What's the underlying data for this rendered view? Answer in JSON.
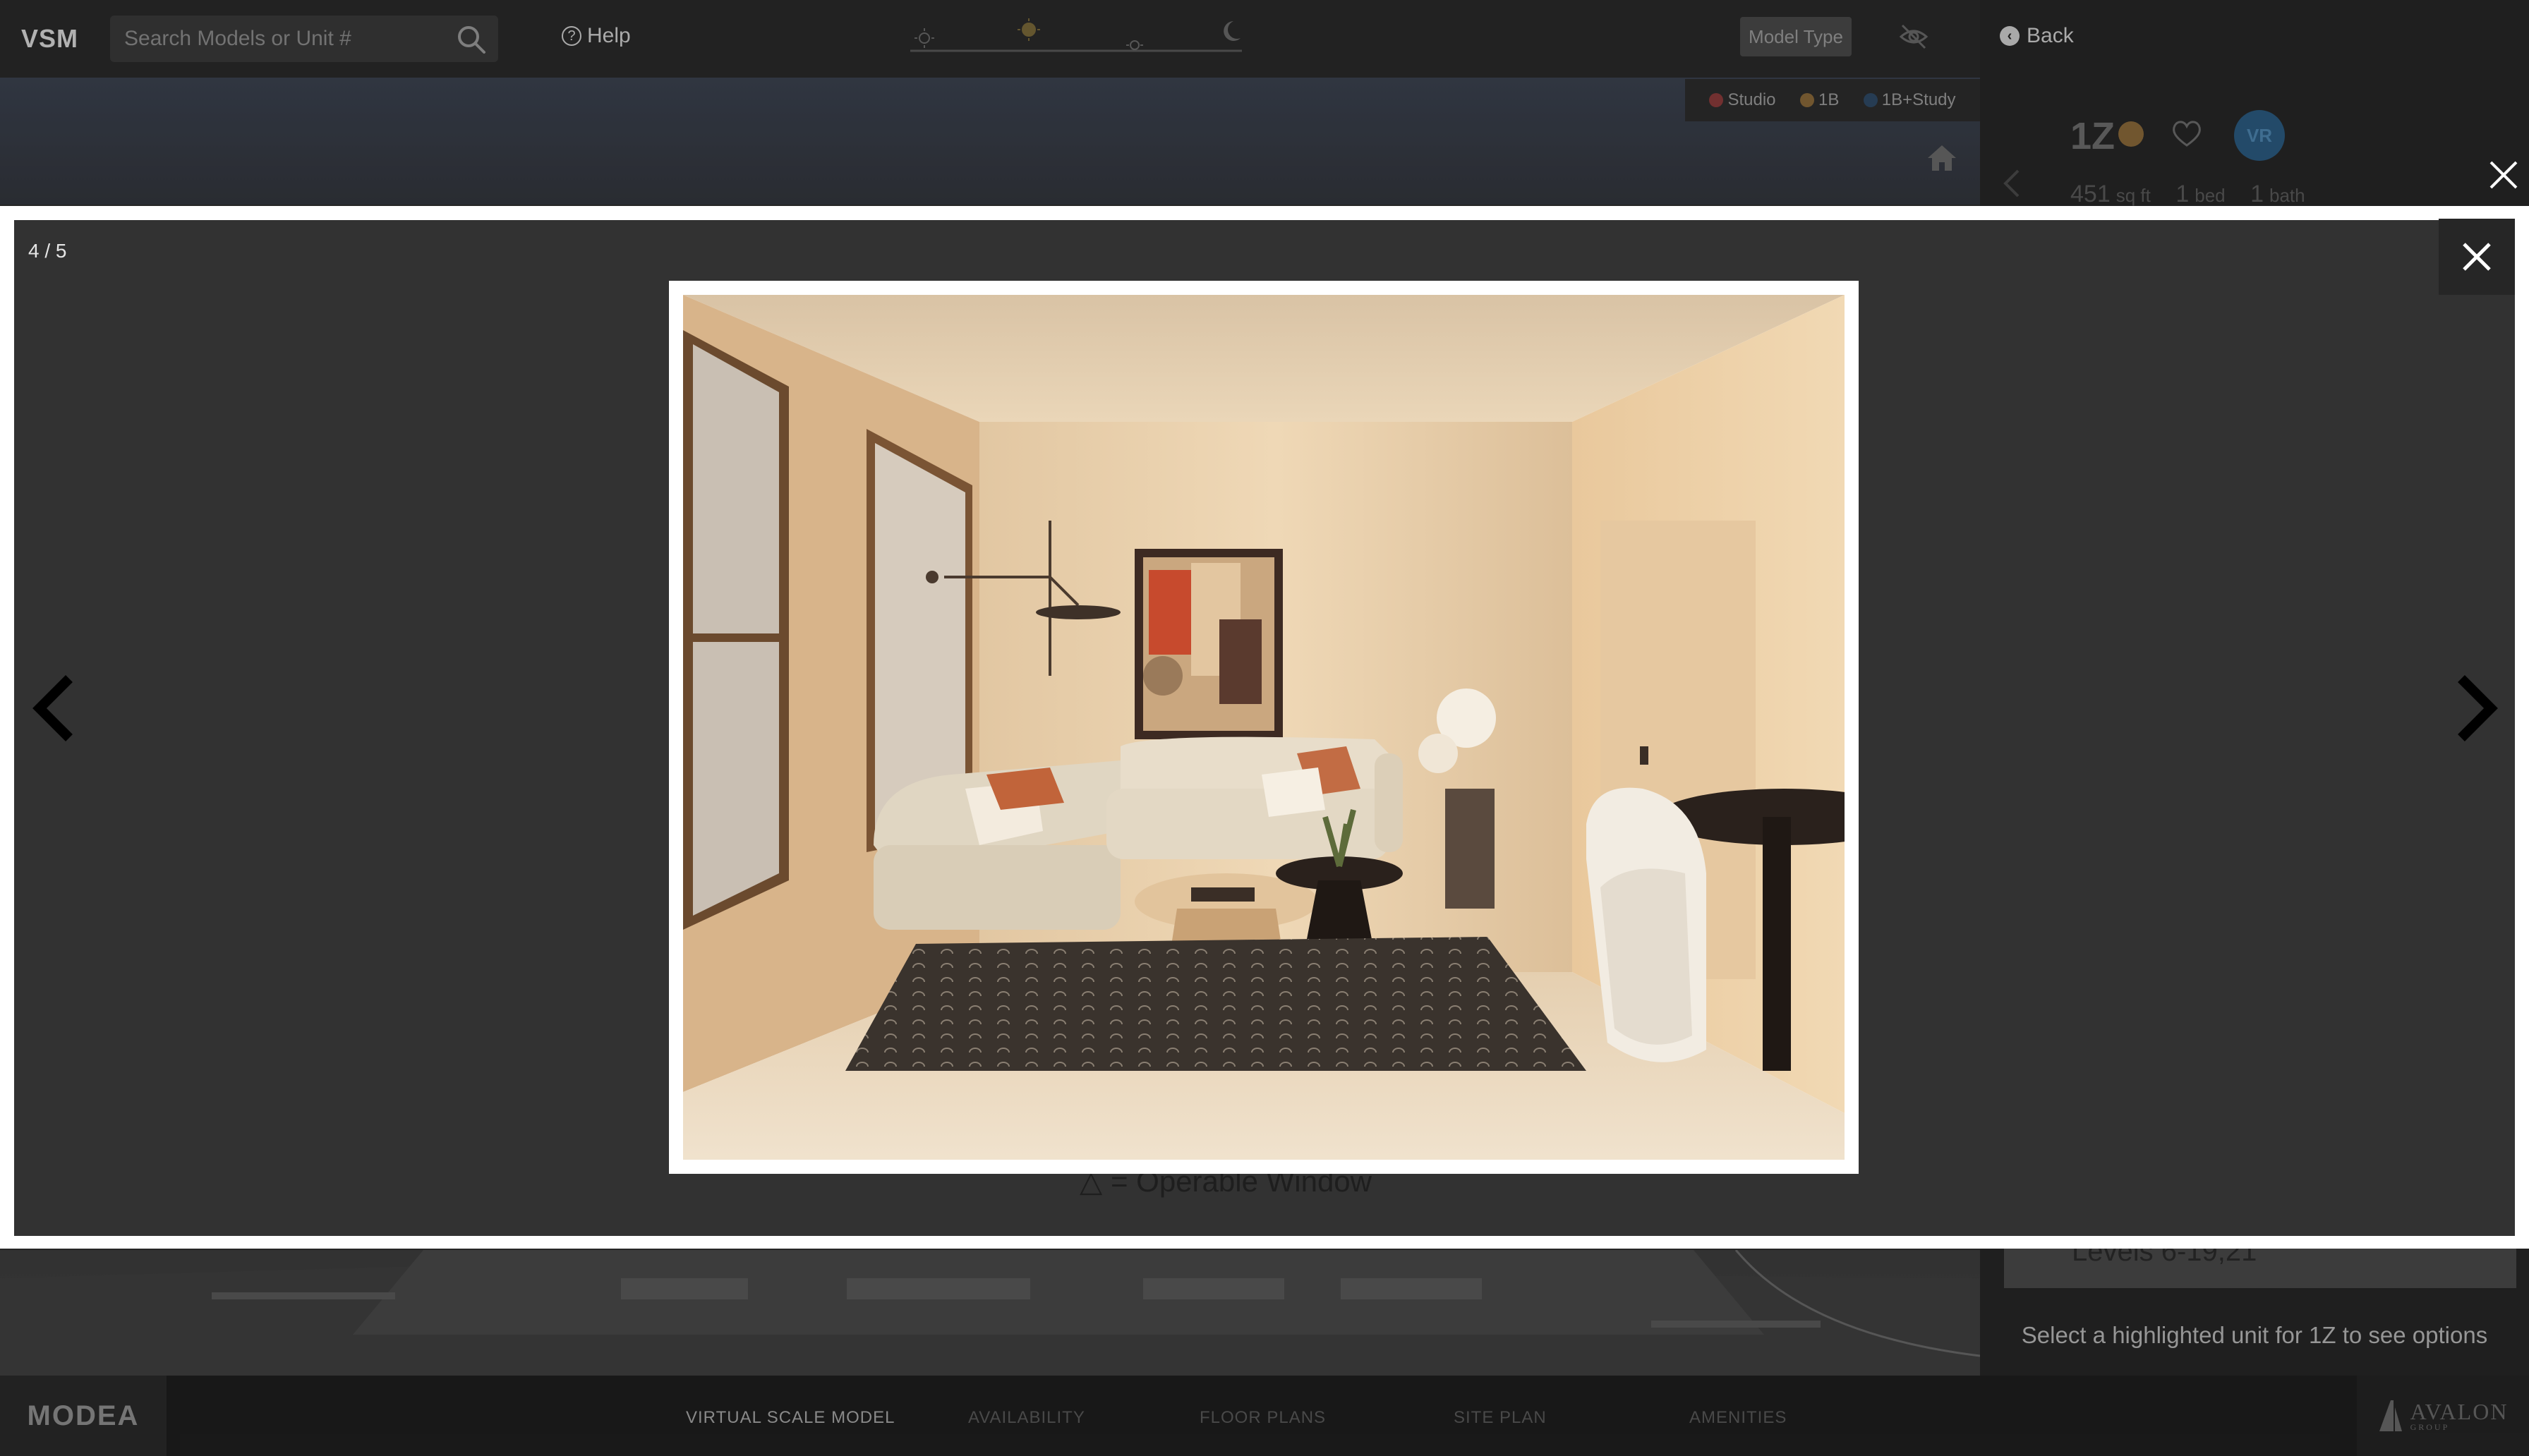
{
  "app": {
    "logo": "VSM",
    "search_placeholder": "Search Models or Unit #",
    "help_label": "Help",
    "model_type_label": "Model Type",
    "legend": [
      {
        "label": "Studio",
        "color": "#8c3b3b"
      },
      {
        "label": "1B",
        "color": "#8a6a3a"
      },
      {
        "label": "1B+Study",
        "color": "#2f4a66"
      }
    ]
  },
  "side_panel": {
    "back_label": "Back",
    "unit_name": "1Z",
    "vr_label": "VR",
    "sqft": "451",
    "sqft_unit": "sq ft",
    "beds": "1",
    "beds_unit": "bed",
    "baths": "1",
    "baths_unit": "bath",
    "levels_text": "Levels 6-19,21",
    "select_hint": "Select a highlighted unit for 1Z to see options"
  },
  "bottom_nav": {
    "brand": "MODEA",
    "items": [
      {
        "label": "VIRTUAL SCALE MODEL",
        "active": true
      },
      {
        "label": "AVAILABILITY",
        "active": false
      },
      {
        "label": "FLOOR PLANS",
        "active": false
      },
      {
        "label": "SITE PLAN",
        "active": false
      },
      {
        "label": "AMENITIES",
        "active": false
      }
    ],
    "partner_logo": "AVALON",
    "partner_logo_sub": "GROUP"
  },
  "lightbox": {
    "counter": "4 / 5",
    "behind_text": "△ = Operable Window"
  },
  "icons": {
    "search": "search-icon",
    "help": "question-circle-icon",
    "day_cycle": "sun-moon-icon",
    "hide": "eye-off-icon",
    "home": "home-icon",
    "back": "arrow-left-circle-icon",
    "favorite": "heart-icon",
    "close": "close-icon",
    "prev": "chevron-left-icon",
    "next": "chevron-right-icon"
  }
}
